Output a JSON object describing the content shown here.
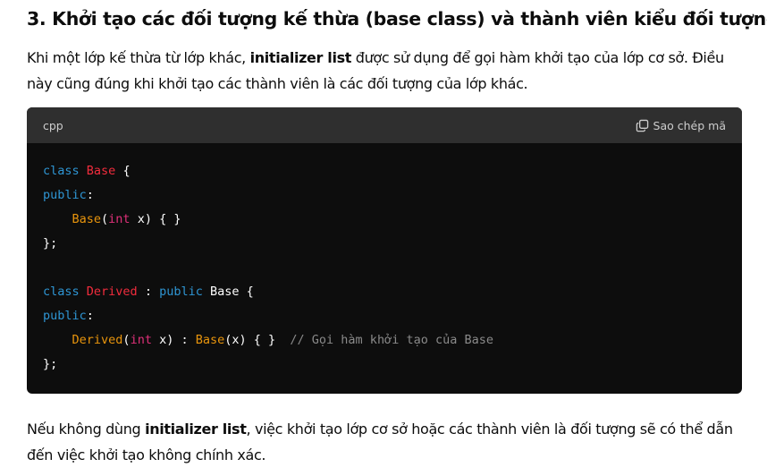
{
  "heading": {
    "number": "3.",
    "text": "Khởi tạo các đối tượng kế thừa (base class) và thành viên kiểu đối tượng"
  },
  "paragraph1": {
    "part1": "Khi một lớp kế thừa từ lớp khác, ",
    "bold": "initializer list",
    "part2": " được sử dụng để gọi hàm khởi tạo của lớp cơ sở. Điều này cũng đúng khi khởi tạo các thành viên là các đối tượng của lớp khác."
  },
  "code_block": {
    "language": "cpp",
    "copy_label": "Sao chép mã",
    "tokens": {
      "class_kw": "class",
      "base_name": "Base",
      "derived_name": "Derived",
      "public_kw": "public",
      "int_kw": "int",
      "comment": "// Gọi hàm khởi tạo của Base"
    }
  },
  "paragraph2": {
    "part1": "Nếu không dùng ",
    "bold": "initializer list",
    "part2": ", việc khởi tạo lớp cơ sở hoặc các thành viên là đối tượng sẽ có thể dẫn đến việc khởi tạo không chính xác."
  },
  "colors": {
    "keyword": "#2e95d3",
    "class_name": "#f22c3d",
    "function_name": "#e9950c",
    "type": "#df3079",
    "comment": "#8a8a8a",
    "code_bg": "#0d0d0d",
    "header_bg": "#2f2f2f"
  }
}
